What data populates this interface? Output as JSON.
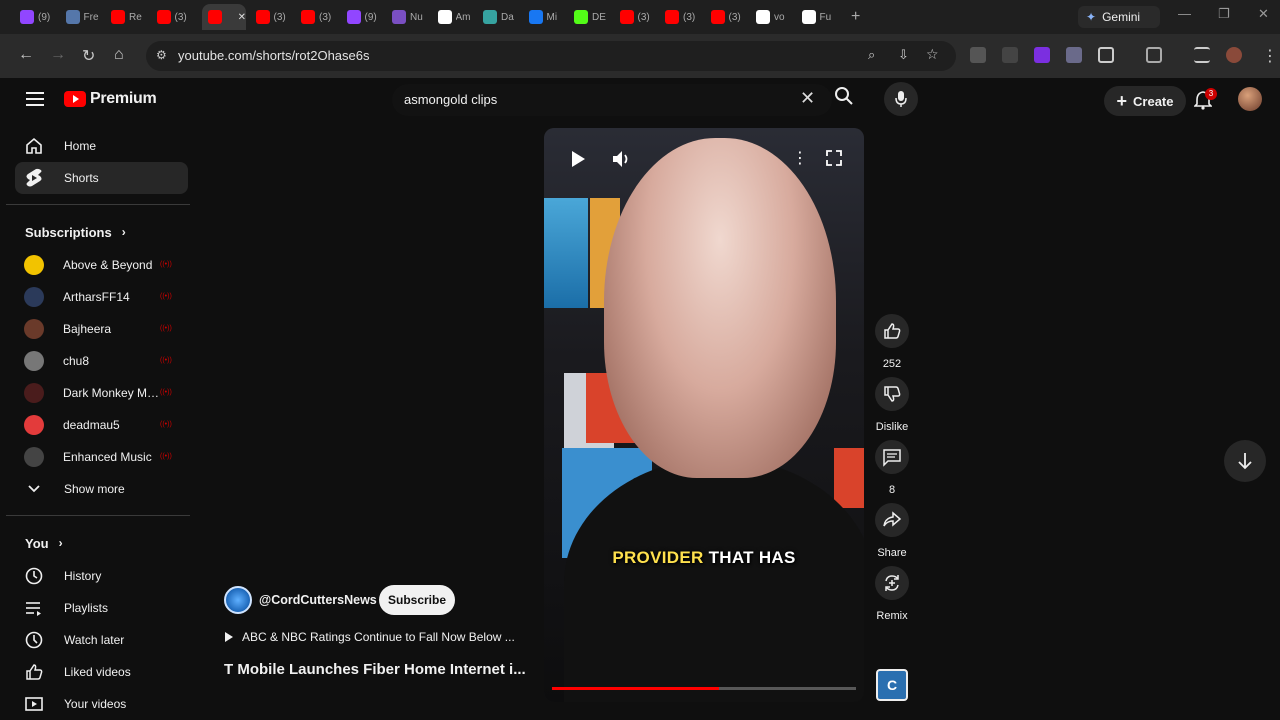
{
  "browser": {
    "tabs": [
      {
        "label": "(9)",
        "favicon": "twitch-icon",
        "color": "#9146ff"
      },
      {
        "label": "Fre",
        "favicon": "j-icon",
        "color": "#5577aa"
      },
      {
        "label": "Re",
        "favicon": "youtube-icon",
        "color": "#ff0000"
      },
      {
        "label": "(3)",
        "favicon": "youtube-icon",
        "color": "#ff0000"
      },
      {
        "label": "",
        "favicon": "youtube-icon",
        "color": "#ff0000",
        "active": true
      },
      {
        "label": "(3)",
        "favicon": "youtube-icon",
        "color": "#ff0000"
      },
      {
        "label": "(3)",
        "favicon": "youtube-icon",
        "color": "#ff0000"
      },
      {
        "label": "(9)",
        "favicon": "twitch-icon",
        "color": "#9146ff"
      },
      {
        "label": "Nu",
        "favicon": "nu-icon",
        "color": "#7a4fc2"
      },
      {
        "label": "Am",
        "favicon": "amazon-icon",
        "color": "#ffffff"
      },
      {
        "label": "Da",
        "favicon": "globe-icon",
        "color": "#36a3a0"
      },
      {
        "label": "Mi",
        "favicon": "facebook-icon",
        "color": "#1877f2"
      },
      {
        "label": "DE",
        "favicon": "k-icon",
        "color": "#53fc18"
      },
      {
        "label": "(3)",
        "favicon": "youtube-icon",
        "color": "#ff0000"
      },
      {
        "label": "(3)",
        "favicon": "youtube-icon",
        "color": "#ff0000"
      },
      {
        "label": "(3)",
        "favicon": "youtube-icon",
        "color": "#ff0000"
      },
      {
        "label": "vo",
        "favicon": "google-icon",
        "color": "#ffffff"
      },
      {
        "label": "Fu",
        "favicon": "threads-icon",
        "color": "#ffffff"
      }
    ],
    "gemini_label": "Gemini",
    "url": "youtube.com/shorts/rot2Ohase6s"
  },
  "youtube": {
    "logo_text": "Premium",
    "search_value": "asmongold clips",
    "create_label": "Create",
    "notification_count": "3"
  },
  "sidebar": {
    "home": "Home",
    "shorts": "Shorts",
    "subscriptions_title": "Subscriptions",
    "subscriptions": [
      {
        "name": "Above & Beyond",
        "color": "#f2c300"
      },
      {
        "name": "ArtharsFF14",
        "color": "#2b3a5a"
      },
      {
        "name": "Bajheera",
        "color": "#6a3a2a"
      },
      {
        "name": "chu8",
        "color": "#777777"
      },
      {
        "name": "Dark Monkey Mu...",
        "color": "#4a1c1c"
      },
      {
        "name": "deadmau5",
        "color": "#e33b3b"
      },
      {
        "name": "Enhanced Music",
        "color": "#444444"
      }
    ],
    "show_more": "Show more",
    "you_title": "You",
    "you_items": [
      "History",
      "Playlists",
      "Watch later",
      "Liked videos",
      "Your videos"
    ]
  },
  "short": {
    "caption_highlight": "PROVIDER",
    "caption_rest": " THAT HAS",
    "progress_fraction": 0.55,
    "channel_handle": "@CordCuttersNews",
    "subscribe_label": "Subscribe",
    "related_text": "ABC & NBC Ratings Continue to Fall Now Below ...",
    "title": "T Mobile Launches Fiber Home Internet i..."
  },
  "actions": {
    "like_count": "252",
    "dislike_label": "Dislike",
    "comment_count": "8",
    "share_label": "Share",
    "remix_label": "Remix"
  }
}
